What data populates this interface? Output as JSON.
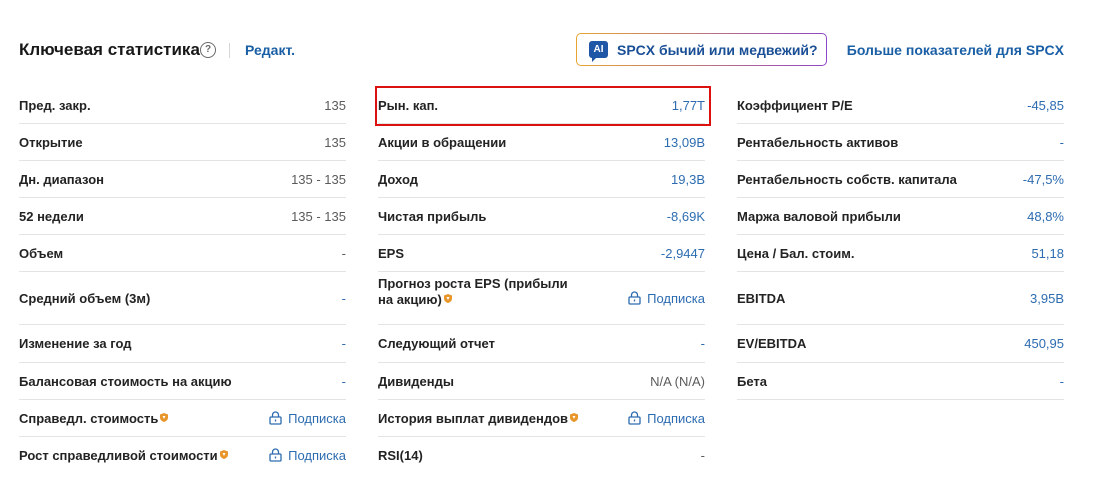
{
  "header": {
    "title": "Ключевая статистика",
    "help_glyph": "?",
    "edit_label": "Редакт.",
    "ai_icon_text": "AI",
    "ai_button_label": "SPCX бычий или медвежий?",
    "more_link": "Больше показателей для SPCX"
  },
  "columns": [
    {
      "rows": [
        {
          "label": "Пред. закр.",
          "value": "135"
        },
        {
          "label": "Открытие",
          "value": "135"
        },
        {
          "label": "Дн. диапазон",
          "value": "135 - 135"
        },
        {
          "label": "52 недели",
          "value": "135 - 135"
        },
        {
          "label": "Объем",
          "value": "-"
        },
        {
          "label": "Средний объем (3м)",
          "value": "-"
        },
        {
          "label": "Изменение за год",
          "value": "-"
        },
        {
          "label": "Балансовая стоимость на акцию",
          "value": "-"
        },
        {
          "label": "Справедл. стоимость",
          "value": "Подписка"
        },
        {
          "label": "Рост справедливой стоимости",
          "value": "Подписка"
        }
      ]
    },
    {
      "rows": [
        {
          "label": "Рын. кап.",
          "value": "1,77T"
        },
        {
          "label": "Акции в обращении",
          "value": "13,09B"
        },
        {
          "label": "Доход",
          "value": "19,3B"
        },
        {
          "label": "Чистая прибыль",
          "value": "-8,69K"
        },
        {
          "label": "EPS",
          "value": "-2,9447"
        },
        {
          "label": "Прогноз роста EPS (прибыли на акцию)",
          "value": "Подписка"
        },
        {
          "label": "Следующий отчет",
          "value": "-"
        },
        {
          "label": "Дивиденды",
          "value": "N/A (N/A)"
        },
        {
          "label": "История выплат дивидендов",
          "value": "Подписка"
        },
        {
          "label": "RSI(14)",
          "value": "-"
        }
      ]
    },
    {
      "rows": [
        {
          "label": "Коэффициент P/E",
          "value": "-45,85"
        },
        {
          "label": "Рентабельность активов",
          "value": "-"
        },
        {
          "label": "Рентабельность собств. капитала",
          "value": "-47,5%"
        },
        {
          "label": "Маржа валовой прибыли",
          "value": "48,8%"
        },
        {
          "label": "Цена / Бал. стоим.",
          "value": "51,18"
        },
        {
          "label": "EBITDA",
          "value": "3,95B"
        },
        {
          "label": "EV/EBITDA",
          "value": "450,95"
        },
        {
          "label": "Бета",
          "value": "-"
        }
      ]
    }
  ],
  "colors": {
    "link": "#2d6cb0",
    "highlight": "#dd1010",
    "premium_badge": "#e8962a"
  }
}
